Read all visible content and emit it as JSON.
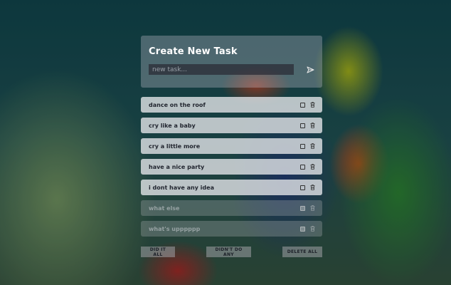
{
  "header": {
    "title": "Create New Task",
    "input_placeholder": "new task..."
  },
  "tasks": [
    {
      "label": "dance on the roof",
      "completed": false
    },
    {
      "label": "cry like a baby",
      "completed": false
    },
    {
      "label": "cry a little more",
      "completed": false
    },
    {
      "label": "have a nice party",
      "completed": false
    },
    {
      "label": "i dont have any idea",
      "completed": false
    },
    {
      "label": "what else",
      "completed": true
    },
    {
      "label": "what's upppppp",
      "completed": true
    }
  ],
  "footer": {
    "did_it_all": "DID IT ALL",
    "didnt_do_any": "DIDN'T DO ANY",
    "delete_all": "DELETE ALL"
  },
  "icons": {
    "send": "send-icon",
    "check": "checkbox-icon",
    "trash": "trash-icon"
  }
}
